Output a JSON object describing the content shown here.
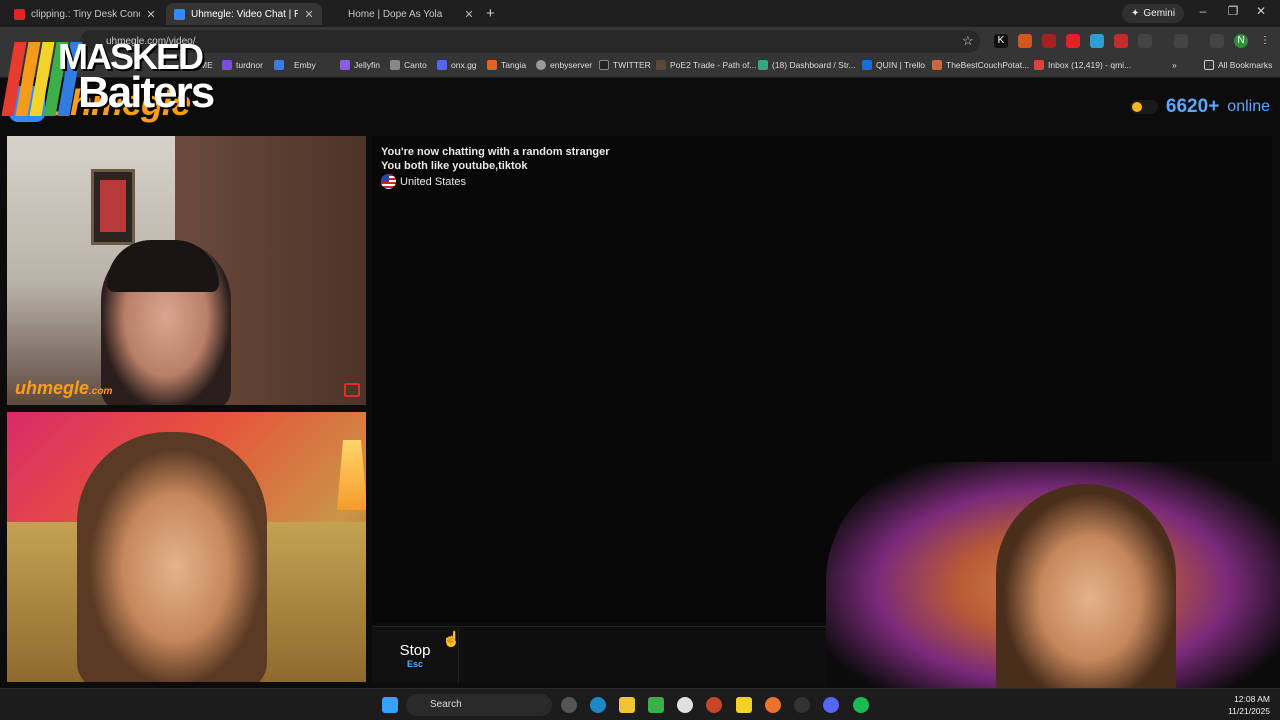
{
  "browser": {
    "tabs": [
      {
        "title": "clipping.: Tiny Desk Concert - Y",
        "color": "#e02424"
      },
      {
        "title": "Uhmegle: Video Chat | Ran",
        "color": "#2f8cff"
      },
      {
        "title": "Home | Dope As Yola",
        "color": "#1f1f1f"
      }
    ],
    "new_tab": "+",
    "gemini_label": "Gemini",
    "address": "uhmegle.com/video/",
    "bookmarks": [
      "ME",
      "turdnor",
      "Emby",
      "Jellyfin",
      "Canto",
      "onx.gg",
      "Tangia",
      "enbyserver",
      "TWITTER",
      "PoE2 Trade - Path of...",
      "(18) Dashboard / Str...",
      "QUIN | Trello",
      "TheBestCouchPotat...",
      "Inbox (12,419) - qmi..."
    ],
    "all_bookmarks": "All Bookmarks"
  },
  "overlay": {
    "masked_line1": "MASKED",
    "masked_line2": "Baiters"
  },
  "site": {
    "logo": "uhmegle",
    "online_count": "6620+",
    "online_label": "online",
    "watermark": "uhmegle",
    "watermark_suffix": ".com"
  },
  "chat": {
    "line1": "You're now chatting with a random stranger",
    "line2": "You both like youtube,tiktok",
    "country": "United States"
  },
  "controls": {
    "stop_label": "Stop",
    "stop_key": "Esc"
  },
  "taskbar": {
    "search_label": "Search",
    "time": "12:08 AM",
    "date": "11/21/2025"
  }
}
